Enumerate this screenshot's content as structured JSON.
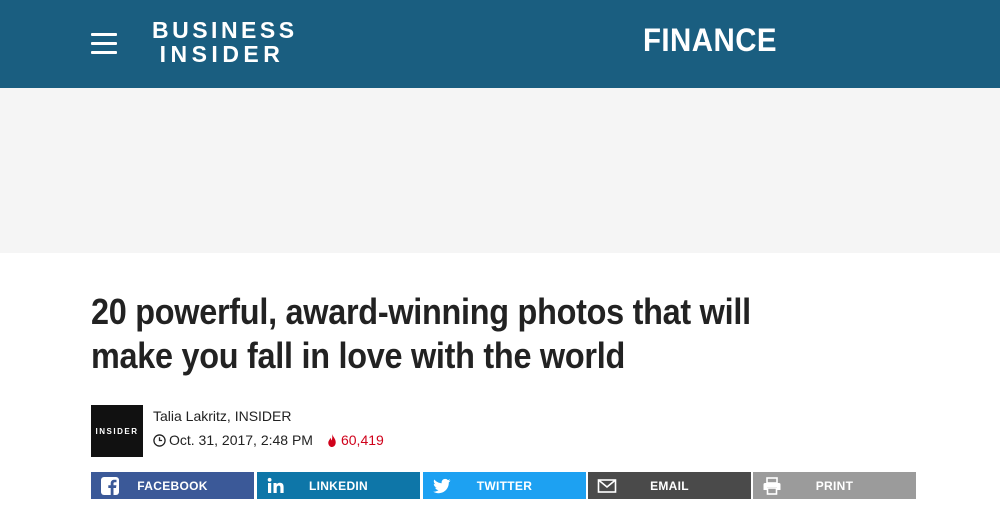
{
  "header": {
    "menu_icon": "hamburger-icon",
    "logo_line1": "BUSINESS",
    "logo_line2": "INSIDER",
    "section": "FINANCE",
    "background_color": "#1a5e80"
  },
  "article": {
    "headline": "20 powerful, award-winning photos that will make you fall in love with the world",
    "source_logo_text": "INSIDER",
    "author": "Talia Lakritz, INSIDER",
    "timestamp": "Oct. 31, 2017, 2:48 PM",
    "views": "60,419",
    "views_color": "#d0021b"
  },
  "share": {
    "buttons": [
      {
        "label": "FACEBOOK",
        "icon": "facebook-icon",
        "color": "#3b5998"
      },
      {
        "label": "LINKEDIN",
        "icon": "linkedin-icon",
        "color": "#0e76a8"
      },
      {
        "label": "TWITTER",
        "icon": "twitter-icon",
        "color": "#1da1f2"
      },
      {
        "label": "EMAIL",
        "icon": "email-icon",
        "color": "#4a4a4a"
      },
      {
        "label": "PRINT",
        "icon": "print-icon",
        "color": "#9b9b9b"
      }
    ]
  }
}
